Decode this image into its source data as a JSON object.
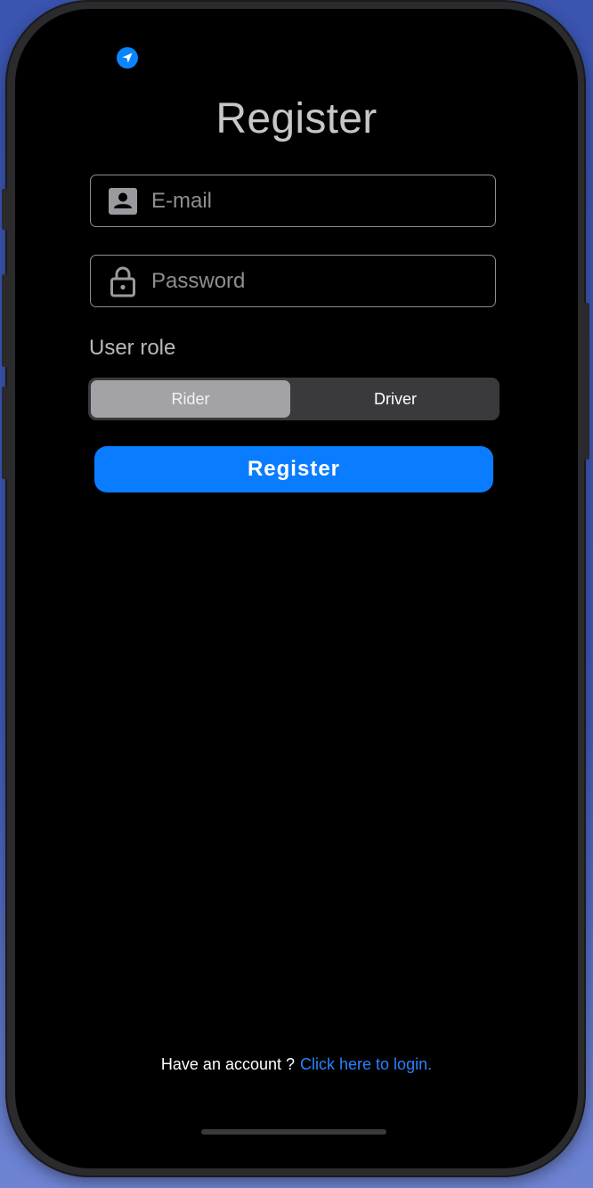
{
  "title": "Register",
  "email": {
    "placeholder": "E-mail",
    "icon": "person-card-icon"
  },
  "password": {
    "placeholder": "Password",
    "icon": "lock-icon"
  },
  "role": {
    "label": "User role",
    "options": [
      "Rider",
      "Driver"
    ],
    "selected": "Rider"
  },
  "register_button": "Register",
  "footer": {
    "prompt": "Have an account ?",
    "link": "Click here to login."
  },
  "colors": {
    "accent": "#0a7cff",
    "background": "#000000"
  }
}
